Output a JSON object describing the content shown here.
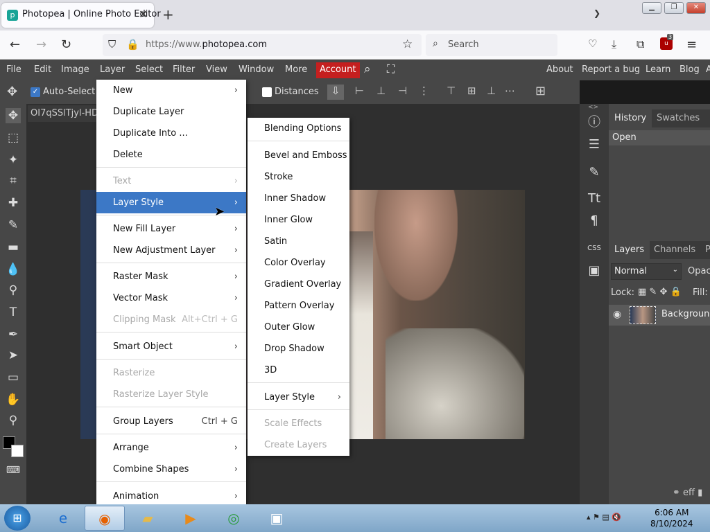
{
  "browser": {
    "tab_title": "Photopea | Online Photo Editor",
    "tab_close": "✕",
    "new_tab": "+",
    "url_prefix": "https://www.",
    "url_host": "photopea.com",
    "search_placeholder": "Search",
    "ext_badge": "3"
  },
  "menubar": {
    "items": [
      "File",
      "Edit",
      "Image",
      "Layer",
      "Select",
      "Filter",
      "View",
      "Window",
      "More"
    ],
    "account": "Account",
    "right_items": [
      "About",
      "Report a bug",
      "Learn",
      "Blog",
      "A"
    ]
  },
  "options": {
    "auto_select": "Auto-Select",
    "distances": "Distances"
  },
  "document": {
    "tab_title": "OI7qSSlTjyl-HD"
  },
  "history_panel": {
    "tabs": [
      "History",
      "Swatches"
    ],
    "items": [
      "Open"
    ]
  },
  "layers_panel": {
    "tabs": [
      "Layers",
      "Channels",
      "P"
    ],
    "blend_mode": "Normal",
    "opacity_label": "Opac",
    "lock_label": "Lock:",
    "fill_label": "Fill:",
    "layer_name": "Background"
  },
  "layer_menu": {
    "items": [
      {
        "label": "New",
        "arrow": true
      },
      {
        "label": "Duplicate Layer"
      },
      {
        "label": "Duplicate Into ..."
      },
      {
        "label": "Delete"
      },
      {
        "label": "Text",
        "arrow": true,
        "disabled": true
      },
      {
        "label": "Layer Style",
        "arrow": true,
        "highlighted": true
      },
      {
        "label": "New Fill Layer",
        "arrow": true
      },
      {
        "label": "New Adjustment Layer",
        "arrow": true
      },
      {
        "label": "Raster Mask",
        "arrow": true
      },
      {
        "label": "Vector Mask",
        "arrow": true
      },
      {
        "label": "Clipping Mask",
        "shortcut": "Alt+Ctrl + G",
        "disabled": true
      },
      {
        "label": "Smart Object",
        "arrow": true
      },
      {
        "label": "Rasterize",
        "disabled": true
      },
      {
        "label": "Rasterize Layer Style",
        "disabled": true
      },
      {
        "label": "Group Layers",
        "shortcut": "Ctrl + G"
      },
      {
        "label": "Arrange",
        "arrow": true
      },
      {
        "label": "Combine Shapes",
        "arrow": true
      },
      {
        "label": "Animation",
        "arrow": true
      }
    ]
  },
  "style_menu": {
    "items": [
      {
        "label": "Blending Options"
      },
      {
        "label": "Bevel and Emboss"
      },
      {
        "label": "Stroke"
      },
      {
        "label": "Inner Shadow"
      },
      {
        "label": "Inner Glow"
      },
      {
        "label": "Satin"
      },
      {
        "label": "Color Overlay"
      },
      {
        "label": "Gradient Overlay"
      },
      {
        "label": "Pattern Overlay"
      },
      {
        "label": "Outer Glow"
      },
      {
        "label": "Drop Shadow"
      },
      {
        "label": "3D"
      },
      {
        "label": "Layer Style",
        "arrow": true
      },
      {
        "label": "Scale Effects",
        "disabled": true
      },
      {
        "label": "Create Layers",
        "disabled": true
      }
    ]
  },
  "taskbar": {
    "time": "6:06 AM",
    "date": "8/10/2024"
  },
  "colors": {
    "account_red": "#c51f1f",
    "highlight_blue": "#3c78c6",
    "panel_gray": "#474747"
  }
}
